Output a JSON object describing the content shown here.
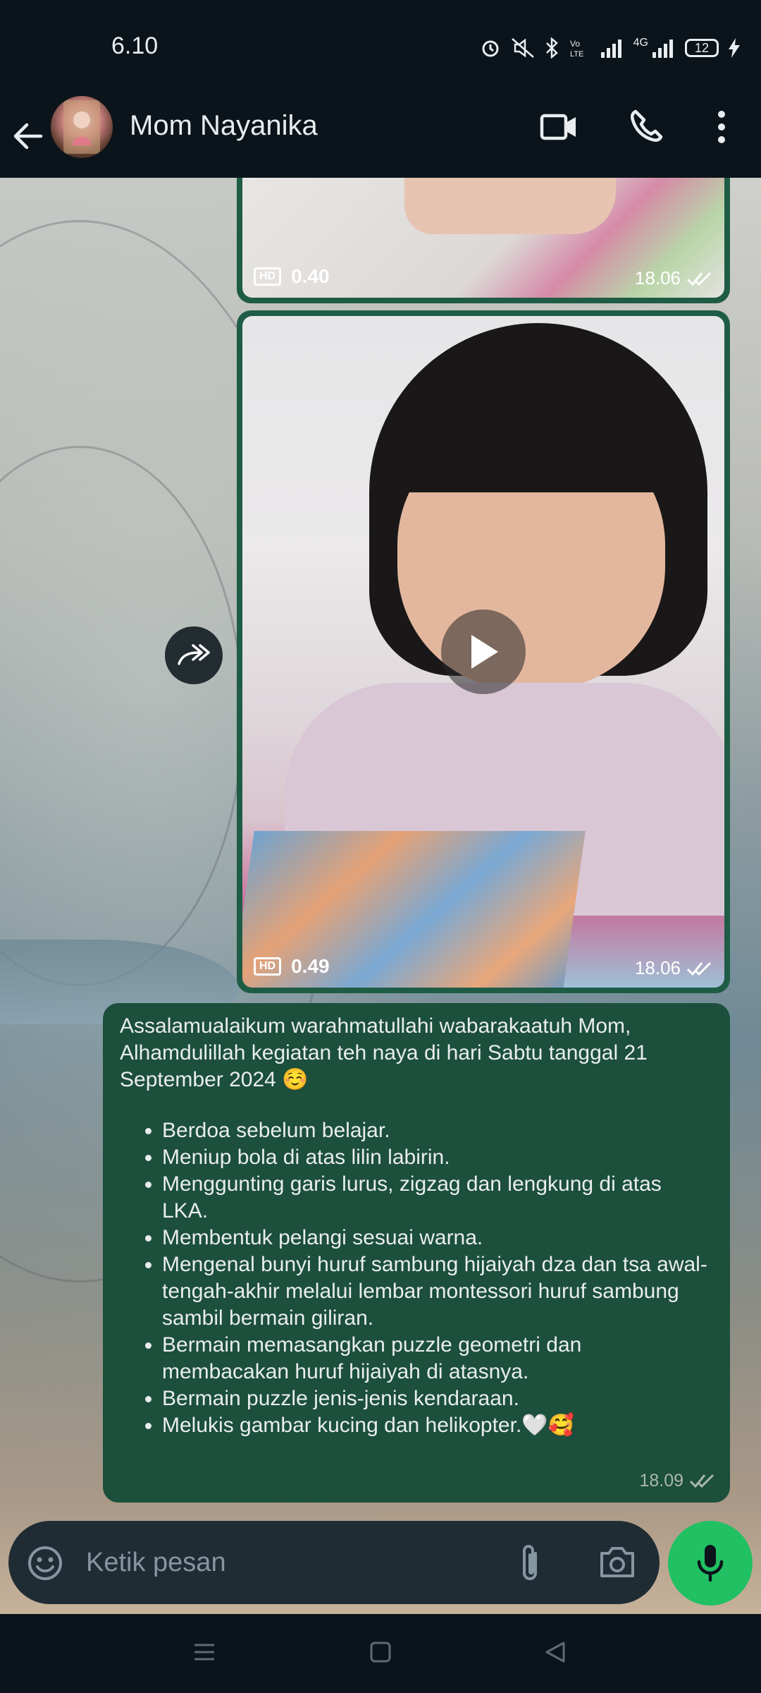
{
  "status_bar": {
    "time": "6.10",
    "battery": "12",
    "network": "4G"
  },
  "header": {
    "contact_name": "Mom Nayanika"
  },
  "messages": [
    {
      "type": "video",
      "hd": "HD",
      "duration": "0.40",
      "time": "18.06"
    },
    {
      "type": "video",
      "hd": "HD",
      "duration": "0.49",
      "time": "18.06"
    },
    {
      "type": "text",
      "intro": "Assalamualaikum warahmatullahi wabarakaatuh Mom, Alhamdulillah kegiatan teh naya di hari Sabtu tanggal 21 September 2024 ☺️",
      "items": [
        "Berdoa sebelum belajar.",
        "Meniup bola di atas lilin labirin.",
        "Menggunting garis lurus, zigzag dan lengkung di atas LKA.",
        "Membentuk pelangi sesuai warna.",
        "Mengenal bunyi huruf sambung hijaiyah dza dan tsa awal-tengah-akhir melalui lembar montessori huruf sambung sambil bermain giliran.",
        "Bermain memasangkan puzzle geometri dan membacakan huruf hijaiyah di atasnya.",
        "Bermain puzzle jenis-jenis kendaraan.",
        "Melukis gambar kucing dan helikopter.🤍🥰"
      ],
      "time": "18.09"
    }
  ],
  "input": {
    "placeholder": "Ketik pesan"
  },
  "colors": {
    "outgoing_bubble": "#1c4f3c",
    "mic_button": "#21c063",
    "header_bg": "#0b141a"
  },
  "icons": [
    "back-arrow-icon",
    "video-call-icon",
    "phone-icon",
    "more-icon",
    "forward-icon",
    "play-icon",
    "emoji-icon",
    "attach-icon",
    "camera-icon",
    "mic-icon",
    "double-check-icon"
  ]
}
